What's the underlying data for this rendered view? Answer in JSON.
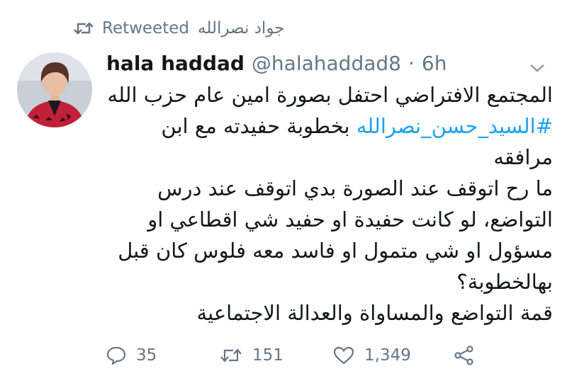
{
  "retweet_banner": {
    "label": "Retweeted",
    "retweeter": "جواد نصرالله"
  },
  "tweet": {
    "author_name": "hala haddad",
    "author_handle": "@halahaddad8",
    "separator": "·",
    "time": "6h",
    "text_before_hashtag": "المجتمع الافتراضي احتفل بصورة امين عام حزب الله ",
    "hashtag": "#السيد_حسن_نصرالله",
    "text_after_hashtag": " بخطوبة حفيدته مع ابن مرافقه",
    "paragraphs": [
      "ما رح اتوقف عند الصورة بدي اتوقف عند درس التواضع، لو كانت حفيدة او حفيد شي اقطاعي او مسؤول او شي متمول او فاسد معه فلوس كان قبل بهالخطوبة؟",
      "قمة التواضع والمساواة والعدالة الاجتماعية"
    ]
  },
  "actions": {
    "replies": "35",
    "retweets": "151",
    "likes": "1,349"
  },
  "icons": {
    "retweet": "retweet-icon",
    "reply": "reply-icon",
    "like": "heart-icon",
    "share": "share-icon",
    "more": "chevron-down-icon"
  },
  "colors": {
    "text": "#14171a",
    "muted": "#657786",
    "link": "#1da1f2"
  }
}
